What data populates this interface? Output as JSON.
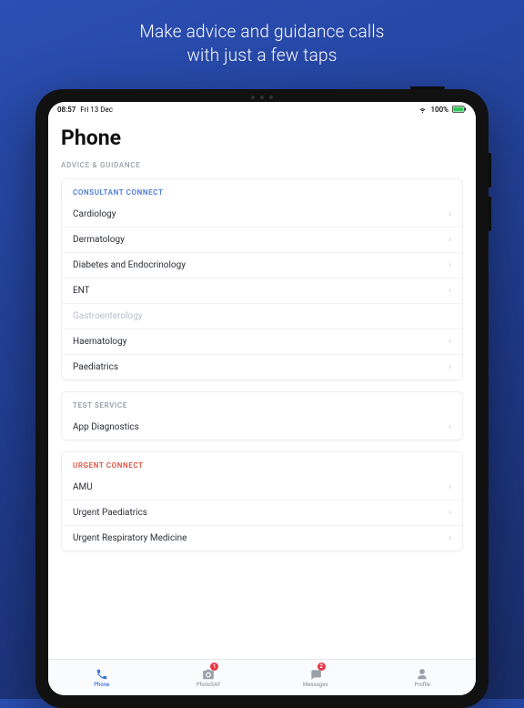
{
  "marketing": {
    "line1": "Make advice and guidance calls",
    "line2": "with just a few taps"
  },
  "status": {
    "time": "08:57",
    "date": "Fri 13 Dec",
    "battery": "100%"
  },
  "page": {
    "title": "Phone",
    "section_label": "ADVICE & GUIDANCE"
  },
  "cards": {
    "consultant": {
      "header": "CONSULTANT CONNECT",
      "items": [
        {
          "label": "Cardiology",
          "enabled": true
        },
        {
          "label": "Dermatology",
          "enabled": true
        },
        {
          "label": "Diabetes and Endocrinology",
          "enabled": true
        },
        {
          "label": "ENT",
          "enabled": true
        },
        {
          "label": "Gastroenterology",
          "enabled": false
        },
        {
          "label": "Haematology",
          "enabled": true
        },
        {
          "label": "Paediatrics",
          "enabled": true
        }
      ]
    },
    "test": {
      "header": "TEST SERVICE",
      "items": [
        {
          "label": "App Diagnostics",
          "enabled": true
        }
      ]
    },
    "urgent": {
      "header": "URGENT CONNECT",
      "items": [
        {
          "label": "AMU",
          "enabled": true
        },
        {
          "label": "Urgent Paediatrics",
          "enabled": true
        },
        {
          "label": "Urgent Respiratory Medicine",
          "enabled": true
        }
      ]
    }
  },
  "tabs": [
    {
      "id": "phone",
      "label": "Phone",
      "icon": "phone-icon",
      "active": true,
      "badge": null
    },
    {
      "id": "photosaf",
      "label": "PhotoSAF",
      "icon": "camera-icon",
      "active": false,
      "badge": "1"
    },
    {
      "id": "messages",
      "label": "Messages",
      "icon": "message-icon",
      "active": false,
      "badge": "2"
    },
    {
      "id": "profile",
      "label": "Profile",
      "icon": "person-icon",
      "active": false,
      "badge": null
    }
  ]
}
